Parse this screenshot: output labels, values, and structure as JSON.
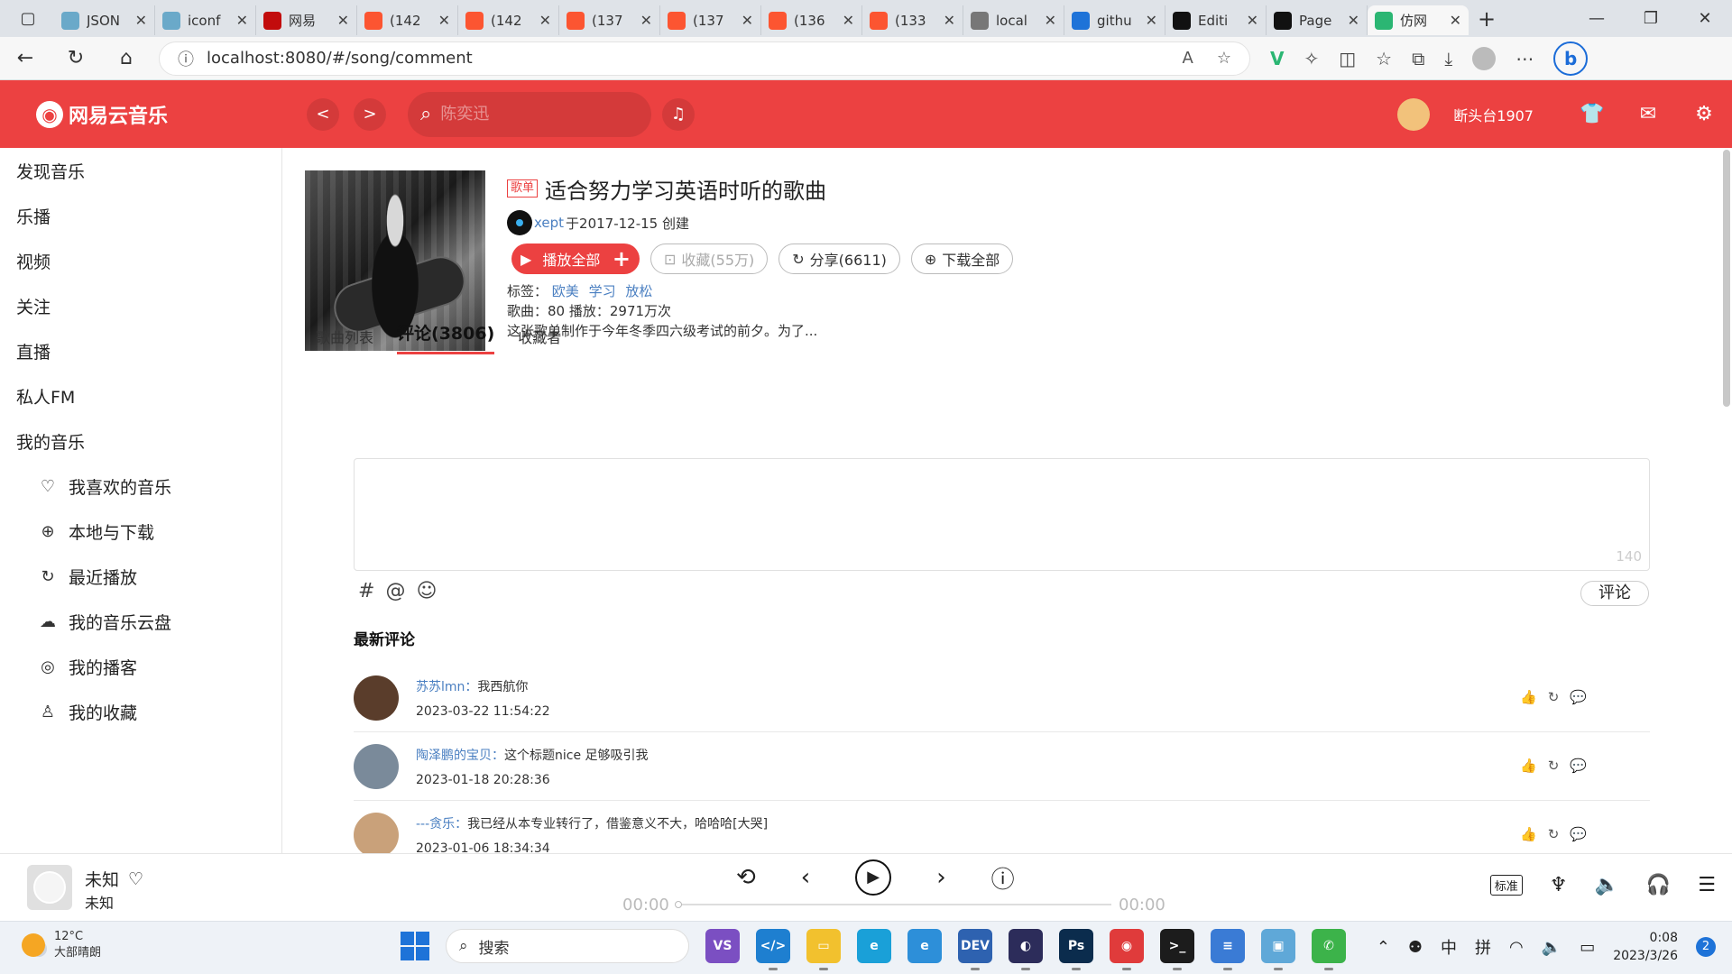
{
  "browser": {
    "tabs": [
      {
        "label": "JSON",
        "icon": "gear-icon",
        "color": "#6aa9c9"
      },
      {
        "label": "iconf",
        "icon": "gear-icon",
        "color": "#6aa9c9"
      },
      {
        "label": "网易",
        "icon": "netease-icon",
        "color": "#c20c0c"
      },
      {
        "label": "(142",
        "icon": "csdn-icon",
        "color": "#fc5531"
      },
      {
        "label": "(142",
        "icon": "csdn-icon",
        "color": "#fc5531"
      },
      {
        "label": "(137",
        "icon": "csdn-icon",
        "color": "#fc5531"
      },
      {
        "label": "(137",
        "icon": "csdn-icon",
        "color": "#fc5531"
      },
      {
        "label": "(136",
        "icon": "csdn-icon",
        "color": "#fc5531"
      },
      {
        "label": "(133",
        "icon": "csdn-icon",
        "color": "#fc5531"
      },
      {
        "label": "local",
        "icon": "page-icon",
        "color": "#777777"
      },
      {
        "label": "githu",
        "icon": "search-icon",
        "color": "#1e73d8"
      },
      {
        "label": "Editi",
        "icon": "github-icon",
        "color": "#111111"
      },
      {
        "label": "Page",
        "icon": "github-icon",
        "color": "#111111"
      },
      {
        "label": "仿网",
        "icon": "vue-icon",
        "color": "#2bb673"
      }
    ],
    "url": "localhost:8080/#/song/comment"
  },
  "header": {
    "logo_text": "网易云音乐",
    "back": "<",
    "forward": ">",
    "search_placeholder": "陈奕迅",
    "username": "断头台1907"
  },
  "sidebar": {
    "items": [
      "发现音乐",
      "乐播",
      "视频",
      "关注",
      "直播",
      "私人FM",
      "我的音乐"
    ],
    "sub_items": [
      {
        "label": "我喜欢的音乐",
        "icon": "heart-icon"
      },
      {
        "label": "本地与下载",
        "icon": "download-icon"
      },
      {
        "label": "最近播放",
        "icon": "history-icon"
      },
      {
        "label": "我的音乐云盘",
        "icon": "cloud-icon"
      },
      {
        "label": "我的播客",
        "icon": "podcast-icon"
      },
      {
        "label": "我的收藏",
        "icon": "user-icon"
      }
    ]
  },
  "playlist": {
    "badge": "歌单",
    "title": "适合努力学习英语时听的歌曲",
    "creator": "xept",
    "created": "于2017-12-15 创建",
    "play_all": "播放全部",
    "collect": "收藏(55万)",
    "share": "分享(6611)",
    "download": "下载全部",
    "tags_label": "标签：",
    "tags": [
      "欧美",
      "学习",
      "放松"
    ],
    "stats": "歌曲：80 播放：2971万次",
    "desc": "这张歌单制作于今年冬季四六级考试的前夕。为了..."
  },
  "tabs": [
    "歌曲列表",
    "评论(3806)",
    "收藏者"
  ],
  "comment_form": {
    "counter": "140",
    "submit": "评论"
  },
  "latest_title": "最新评论",
  "comments": [
    {
      "user": "苏苏lmn：",
      "text": "我西航你",
      "time": "2023-03-22 11:54:22",
      "avatar_color": "#5a3d2b"
    },
    {
      "user": "陶泽鹏的宝贝：",
      "text": "这个标题nice 足够吸引我",
      "time": "2023-01-18 20:28:36",
      "avatar_color": "#7a8a9a"
    },
    {
      "user": "---贪乐：",
      "text": "我已经从本专业转行了，借鉴意义不大，哈哈哈[大哭]",
      "time": "2023-01-06 18:34:34",
      "avatar_color": "#c9a17a"
    }
  ],
  "player": {
    "song": "未知",
    "artist": "未知",
    "time_current": "00:00",
    "time_total": "00:00",
    "progress": 0,
    "quality": "标准"
  },
  "taskbar": {
    "temp": "12°C",
    "weather": "大部晴朗",
    "search": "搜索",
    "ime1": "中",
    "ime2": "拼",
    "time": "0:08",
    "date": "2023/3/26",
    "notifications": "2"
  }
}
